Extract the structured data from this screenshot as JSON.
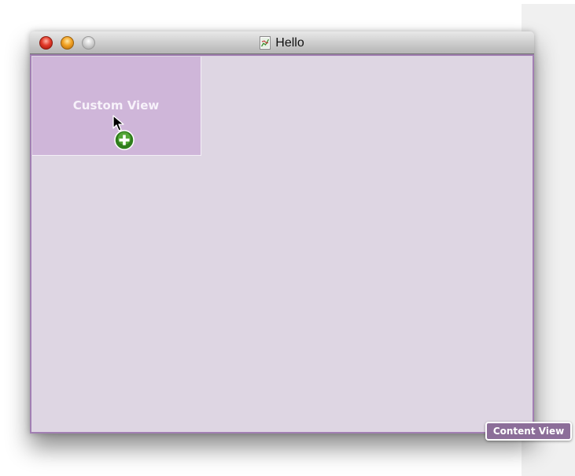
{
  "window": {
    "title": "Hello",
    "icons": {
      "close": "close-traffic-light-icon",
      "minimize": "minimize-traffic-light-icon",
      "zoom": "zoom-traffic-light-icon",
      "document": "document-proxy-icon"
    }
  },
  "custom_view": {
    "label": "Custom View"
  },
  "content_view": {
    "badge_label": "Content View"
  },
  "drag": {
    "cursor_icon": "arrow-cursor-icon",
    "add_icon": "green-plus-drag-icon"
  },
  "colors": {
    "content_background": "#ded6e3",
    "content_border": "#a27fb3",
    "custom_view_background": "#cfb6d9",
    "badge_background": "#8c6e99"
  }
}
